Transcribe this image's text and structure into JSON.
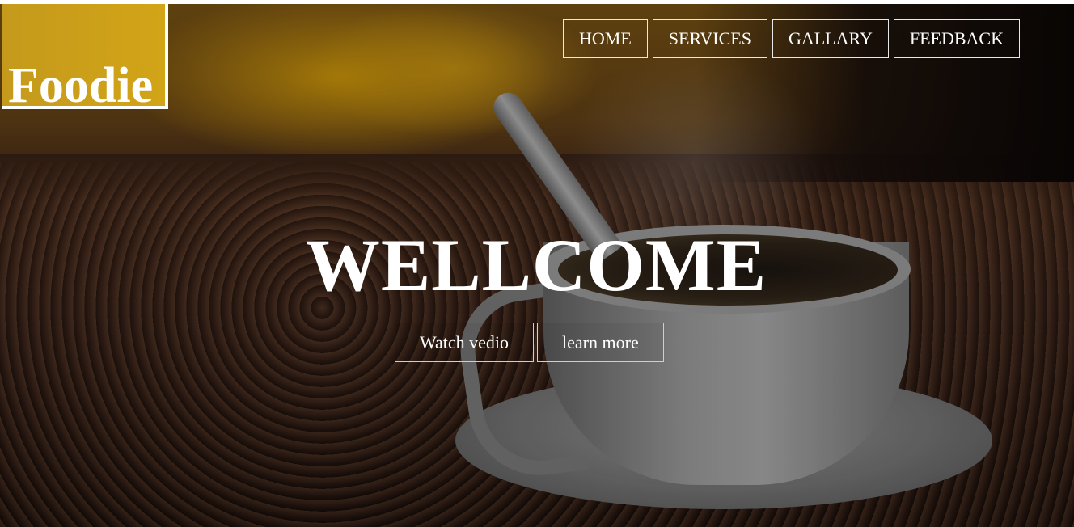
{
  "logo": {
    "text": "Foodie"
  },
  "nav": {
    "items": [
      {
        "label": "HOME"
      },
      {
        "label": "SERVICES"
      },
      {
        "label": "GALLARY"
      },
      {
        "label": "FEEDBACK"
      }
    ]
  },
  "hero": {
    "title": "WELLCOME",
    "buttons": [
      {
        "label": "Watch vedio"
      },
      {
        "label": "learn more"
      }
    ]
  },
  "colors": {
    "logo_background": "#c99f1b",
    "text": "#ffffff",
    "button_border": "#e8e8e8"
  }
}
